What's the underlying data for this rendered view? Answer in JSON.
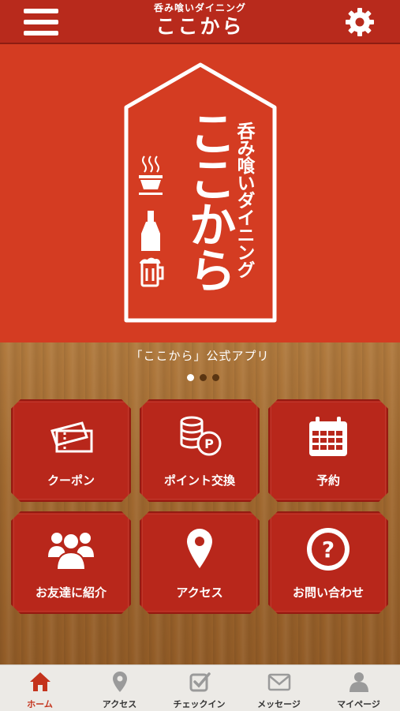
{
  "header": {
    "brand_sub": "呑み喰いダイニング",
    "brand_main": "ここから"
  },
  "hero": {
    "logo_main": "ここから",
    "logo_sub": "呑み喰いダイニング"
  },
  "caption": "「ここから」公式アプリ",
  "carousel": {
    "pages": 3,
    "active": 1
  },
  "tiles": [
    {
      "label": "クーポン",
      "icon": "ticket-icon"
    },
    {
      "label": "ポイント交換",
      "icon": "coins-points-icon"
    },
    {
      "label": "予約",
      "icon": "calendar-icon"
    },
    {
      "label": "お友達に紹介",
      "icon": "group-icon"
    },
    {
      "label": "アクセス",
      "icon": "map-pin-icon"
    },
    {
      "label": "お問い合わせ",
      "icon": "question-icon"
    }
  ],
  "tabs": [
    {
      "label": "ホーム",
      "icon": "home-icon",
      "active": true
    },
    {
      "label": "アクセス",
      "icon": "map-pin-icon",
      "active": false
    },
    {
      "label": "チェックイン",
      "icon": "checkbox-icon",
      "active": false
    },
    {
      "label": "メッセージ",
      "icon": "envelope-icon",
      "active": false
    },
    {
      "label": "マイページ",
      "icon": "person-icon",
      "active": false
    }
  ],
  "colors": {
    "header": "#b82a1c",
    "hero": "#d43c22",
    "tile": "#b8271b",
    "active_tab": "#c4331c",
    "wood": "#a26a30"
  }
}
